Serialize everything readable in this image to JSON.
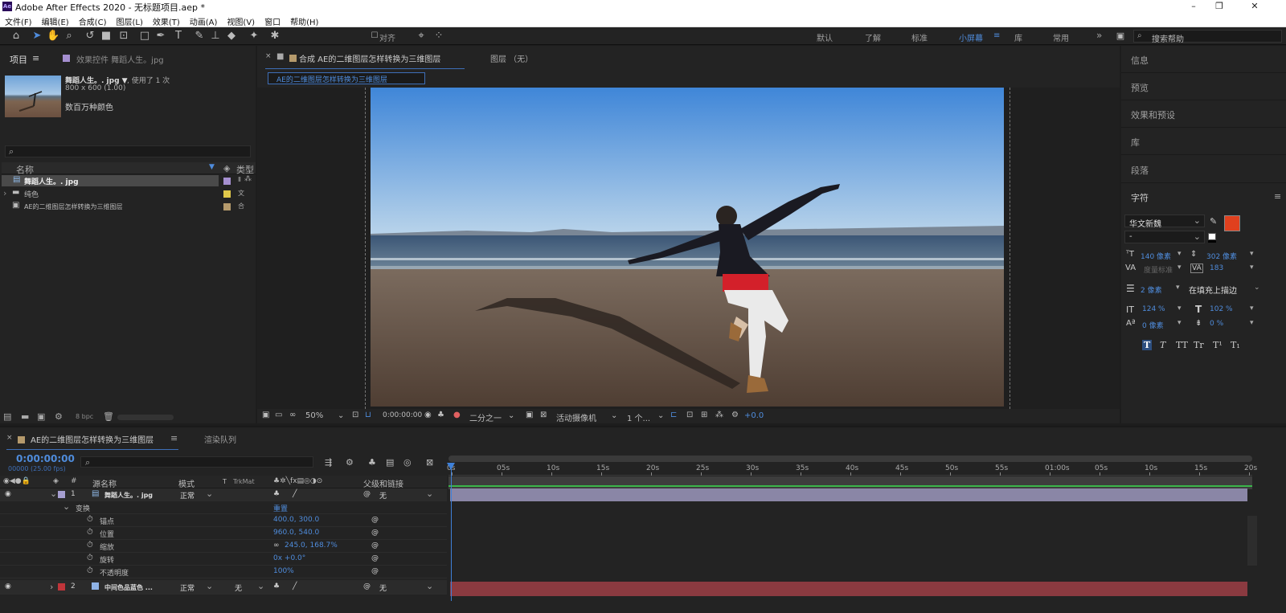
{
  "window": {
    "title": "Adobe After Effects 2020 - 无标题项目.aep *",
    "logo": "Ae",
    "minimize": "–",
    "maximize": "❐",
    "close": "✕"
  },
  "menu": [
    "文件(F)",
    "编辑(E)",
    "合成(C)",
    "图层(L)",
    "效果(T)",
    "动画(A)",
    "视图(V)",
    "窗口",
    "帮助(H)"
  ],
  "toolbar": {
    "snap_label": "对齐",
    "workspaces": [
      "默认",
      "了解",
      "标准",
      "小屏幕",
      "库",
      "常用"
    ],
    "active_workspace": "小屏幕",
    "search_placeholder": "搜索帮助"
  },
  "project": {
    "tab": "项目",
    "effects_tab": "效果控件 舞蹈人生。jpg",
    "asset_name": "舞蹈人生。. jpg ▼",
    "asset_used": ", 使用了 1 次",
    "asset_dims": "800 x 600 (1.00)",
    "asset_colors": "数百万种颜色",
    "col_name": "名称",
    "col_type": "类型",
    "items": [
      {
        "name": "舞蹈人生。. jpg",
        "type": "Ⅱ",
        "swatch": "#a58fd0",
        "kind": "file"
      },
      {
        "name": "纯色",
        "type": "文",
        "swatch": "#e0c84a",
        "kind": "folder"
      },
      {
        "name": "AE的二维图层怎样转换为三维图层",
        "type": "合",
        "swatch": "#b59a6c",
        "kind": "comp"
      }
    ],
    "bpc": "8 bpc"
  },
  "composition": {
    "tab": "合成 AE的二维图层怎样转换为三维图层",
    "layer_tab": "图层 （无）",
    "breadcrumb": "AE的二维图层怎样转换为三维图层",
    "zoom": "50%",
    "timecode": "0:00:00:00",
    "resolution": "二分之一",
    "camera": "活动摄像机",
    "views": "1 个...",
    "exposure": "+0.0"
  },
  "right_panel": {
    "items": [
      "信息",
      "预览",
      "效果和预设",
      "库",
      "段落"
    ],
    "character": "字符",
    "font": "华文新魏",
    "font_style": "-",
    "size": "140 像素",
    "leading": "302 像素",
    "kerning": "度量标准",
    "tracking": "183",
    "stroke_width": "2 像素",
    "stroke_type": "在填充上描边",
    "v_scale": "124 %",
    "h_scale": "102 %",
    "baseline": "0 像素",
    "tsume": "0 %",
    "styles": [
      "T",
      "T",
      "TT",
      "Tr",
      "T¹",
      "T₁"
    ],
    "fill_color": "#e0401e",
    "stroke_color": "#f0c020"
  },
  "timeline": {
    "tab": "AE的二维图层怎样转换为三维图层",
    "render_tab": "渲染队列",
    "timecode": "0:00:00:00",
    "timecode_sub": "00000 (25.00 fps)",
    "col_source": "源名称",
    "col_mode": "模式",
    "col_t": "T",
    "col_trkmat": "TrkMat",
    "col_parent": "父级和链接",
    "layers": [
      {
        "num": "1",
        "name": "舞蹈人生。. jpg",
        "mode": "正常",
        "parent": "无",
        "color": "#a59ed0"
      },
      {
        "num": "2",
        "name": "中间色品蓝色 ...",
        "mode": "正常",
        "trkmat": "无",
        "parent": "无",
        "color": "#c0353a"
      }
    ],
    "transform": "变换",
    "reset": "重置",
    "props": [
      {
        "name": "锚点",
        "value": "400.0, 300.0"
      },
      {
        "name": "位置",
        "value": "960.0, 540.0"
      },
      {
        "name": "缩放",
        "value": "245.0, 168.7%"
      },
      {
        "name": "旋转",
        "value": "0x +0.0°"
      },
      {
        "name": "不透明度",
        "value": "100%"
      }
    ],
    "ticks": [
      "0s",
      "05s",
      "10s",
      "15s",
      "20s",
      "25s",
      "30s",
      "35s",
      "40s",
      "45s",
      "50s",
      "55s",
      "01:00s",
      "05s",
      "10s",
      "15s",
      "20s"
    ]
  }
}
